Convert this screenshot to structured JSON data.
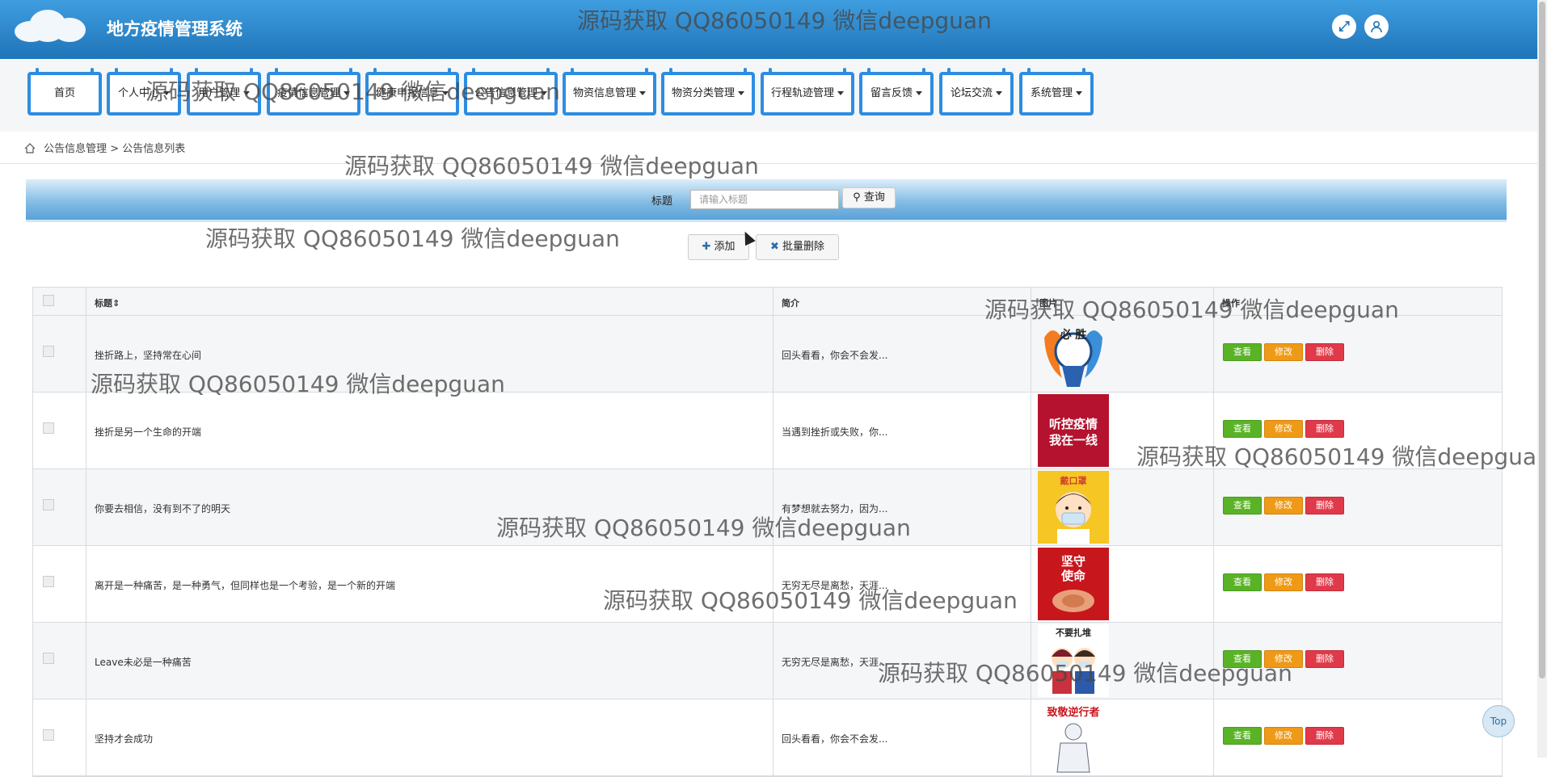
{
  "header": {
    "title": "地方疫情管理系统",
    "fullscreen_icon": "expand-icon",
    "user_icon": "user-icon"
  },
  "nav": [
    {
      "label": "首页",
      "caret": false
    },
    {
      "label": "个人中心",
      "caret": true
    },
    {
      "label": "用户管理",
      "caret": true
    },
    {
      "label": "疫情信息管理",
      "caret": true
    },
    {
      "label": "健康申报信息",
      "caret": true
    },
    {
      "label": "公告信息管理",
      "caret": true
    },
    {
      "label": "物资信息管理",
      "caret": true
    },
    {
      "label": "物资分类管理",
      "caret": true
    },
    {
      "label": "行程轨迹管理",
      "caret": true
    },
    {
      "label": "留言反馈",
      "caret": true
    },
    {
      "label": "论坛交流",
      "caret": true
    },
    {
      "label": "系统管理",
      "caret": true
    }
  ],
  "breadcrumb": {
    "home_icon": "home-icon",
    "text": "公告信息管理 > 公告信息列表"
  },
  "search": {
    "label": "标题",
    "placeholder": "请输入标题",
    "button": "查询"
  },
  "actions": {
    "add": "添加",
    "batch_delete": "批量删除"
  },
  "table": {
    "headers": [
      "标题",
      "简介",
      "图片",
      "操作"
    ],
    "sort_mark": "⇕",
    "rows": [
      {
        "title": "挫折路上，坚持常在心间",
        "summary": "回头看看，你会不会发...",
        "image": "poster-heart-win"
      },
      {
        "title": "挫折是另一个生命的开端",
        "summary": "当遇到挫折或失败，你...",
        "image": "poster-frontline"
      },
      {
        "title": "你要去相信，没有到不了的明天",
        "summary": "有梦想就去努力，因为...",
        "image": "poster-child-mask"
      },
      {
        "title": "离开是一种痛苦，是一种勇气，但同样也是一个考验，是一个新的开端",
        "summary": "无穷无尽是离愁，天涯...",
        "image": "poster-guard-mission"
      },
      {
        "title": "Leave未必是一种痛苦",
        "summary": "无穷无尽是离愁，天涯...",
        "image": "poster-couple-mask"
      },
      {
        "title": "坚持才会成功",
        "summary": "回头看看，你会不会发...",
        "image": "poster-retrograders"
      }
    ],
    "ops": {
      "view": "查看",
      "edit": "修改",
      "delete": "删除"
    }
  },
  "poster_text": {
    "p1": "必    胜",
    "p2a": "听控疫情",
    "p2b": "我在一线",
    "p3": "戴口罩",
    "p4a": "坚守",
    "p4b": "使命",
    "p5": "不要扎堆",
    "p6": "致敬逆行者"
  },
  "watermark": "源码获取 QQ86050149 微信deepguan",
  "top_button": "Top",
  "colors": {
    "header": "#1f74b8",
    "nav_border": "#2d8de0",
    "view": "#5ab327",
    "edit": "#ef9a16",
    "delete": "#e03a4a"
  }
}
